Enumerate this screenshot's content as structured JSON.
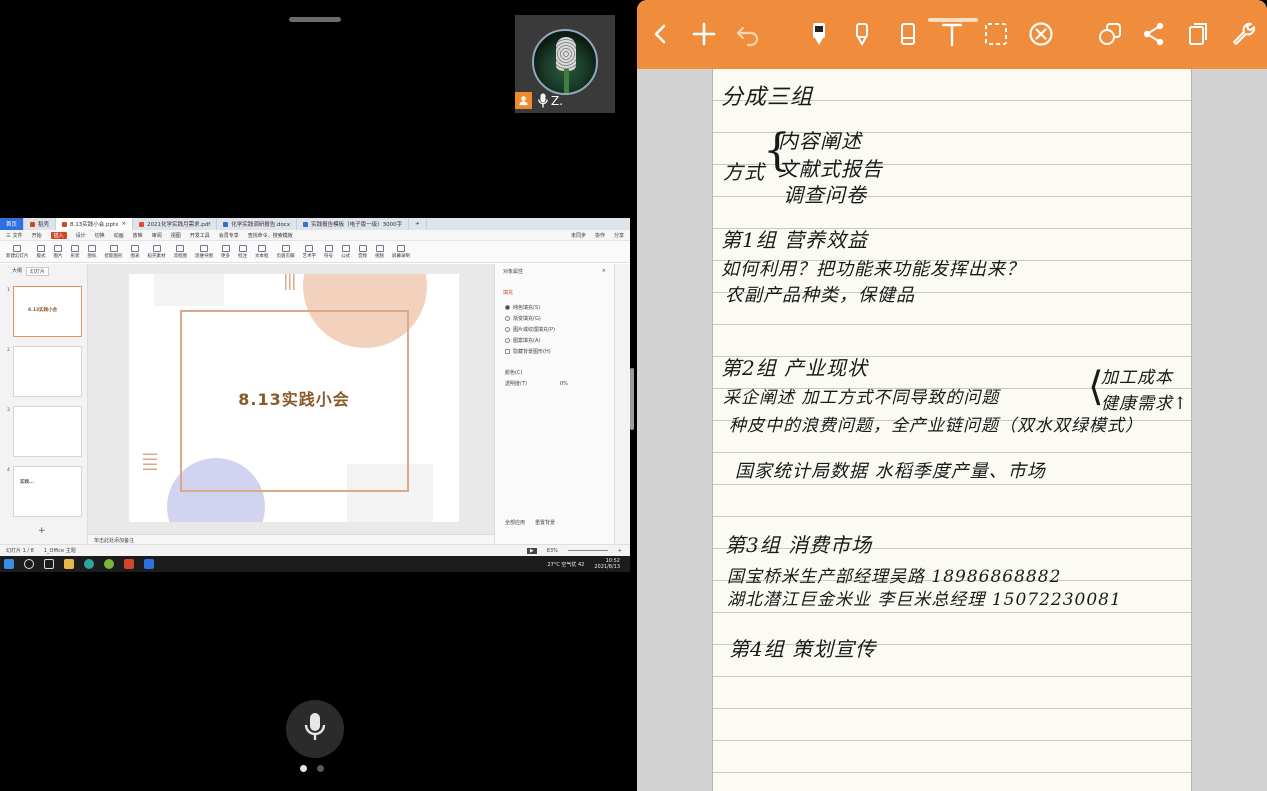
{
  "participant": {
    "name": "Z."
  },
  "ppt": {
    "tabs": [
      {
        "label": "首页",
        "color": "#2f6fe0"
      },
      {
        "label": "稻壳",
        "color": "#d24726"
      },
      {
        "label": "8.13实践小会.pptx",
        "color": "#d24726"
      },
      {
        "label": "2021化学实践月需求.pdf",
        "color": "#e04a3a"
      },
      {
        "label": "化学实践调研报告.docx",
        "color": "#2f6fe0"
      },
      {
        "label": "实践报告模板（电子版一级）3000字",
        "color": "#2f6fe0"
      }
    ],
    "menu": [
      "三 文件",
      "开始",
      "插入",
      "设计",
      "切换",
      "动画",
      "放映",
      "审阅",
      "视图",
      "开发工具",
      "会员专享",
      "查找命令、搜索模板"
    ],
    "menu_right": [
      "未同步",
      "协作",
      "分享"
    ],
    "ribbon": [
      "新建幻灯片",
      "版式",
      "图片",
      "形状",
      "图标",
      "智能图形",
      "图表",
      "稻壳素材",
      "流程图",
      "思维导图",
      "更多",
      "批注",
      "文本框",
      "页眉页脚",
      "艺术字",
      "符号",
      "公式",
      "音频",
      "视频",
      "屏幕录制"
    ],
    "panel_tabs": [
      "大纲",
      "幻灯片"
    ],
    "thumbs": [
      {
        "num": "1",
        "title": "8.13实践小会"
      },
      {
        "num": "2",
        "title": ""
      },
      {
        "num": "3",
        "title": ""
      },
      {
        "num": "4",
        "title": "实践..."
      }
    ],
    "slide_title": "8.13实践小会",
    "notes_placeholder": "单击此处添加备注",
    "props": {
      "header": "对象属性",
      "tab": "填充",
      "options": [
        "纯色填充(S)",
        "渐变填充(G)",
        "图片或纹理填充(P)",
        "图案填充(A)",
        "隐藏背景图形(H)"
      ],
      "color_label": "颜色(C)",
      "transparency_label": "透明度(T)",
      "transparency_value": "0%",
      "bottom": [
        "全部应用",
        "重置背景"
      ]
    },
    "status": {
      "slide": "幻灯片 1 / 8",
      "theme": "1_Office 主题",
      "zoom": "83%"
    },
    "taskbar": {
      "weather": "27°C 空气优 42",
      "time": "10:52",
      "date": "2021/8/13"
    }
  },
  "notes_app": {
    "colors": {
      "toolbar": "#f08d3c",
      "paper": "#fbfbf4"
    },
    "icons": [
      "back-icon",
      "add-icon",
      "undo-icon",
      "pen-icon",
      "highlighter-icon",
      "eraser-icon",
      "text-icon",
      "lasso-icon",
      "clear-icon",
      "shapes-icon",
      "share-icon",
      "pages-icon",
      "settings-icon"
    ],
    "lines": [
      "分成三组",
      "方式",
      "内容阐述",
      "文献式报告",
      "调查问卷",
      "第1组  营养效益",
      "如何利用？把功能来功能发挥出来？",
      "农副产品种类，保健品",
      "第2组  产业现状",
      "采企阐述  加工方式不同导致的问题",
      "加工成本",
      "健康需求↑",
      "种皮中的浪费问题，全产业链问题（双水双绿模式）",
      "国家统计局数据  水稻季度产量、市场",
      "第3组  消费市场",
      "国宝桥米生产部经理吴路 18986868882",
      "湖北潜江巨金米业 李巨米总经理 15072230081",
      "第4组  策划宣传"
    ]
  }
}
